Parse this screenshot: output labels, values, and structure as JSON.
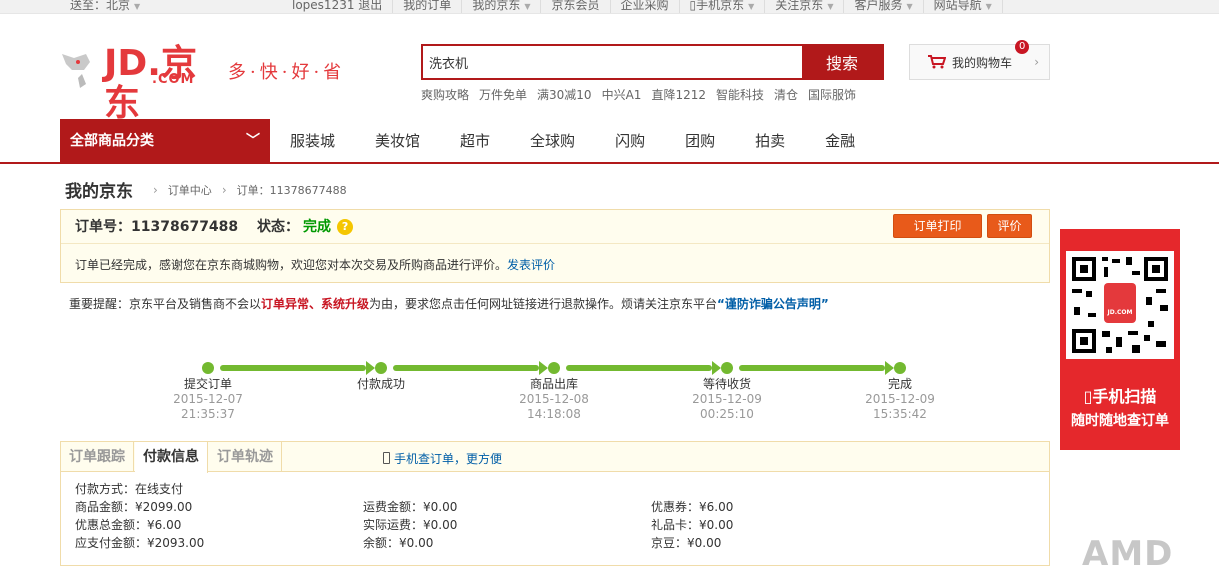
{
  "topbar": {
    "location": "送至：北京",
    "links": [
      "lopes1231  退出",
      "我的订单",
      "我的京东",
      "京东会员",
      "企业采购",
      "手机京东",
      "关注京东",
      "客户服务",
      "网站导航"
    ]
  },
  "logo": {
    "text": "JD.京东",
    "sub": ".COM"
  },
  "slogan": "多·快·好·省",
  "search": {
    "value": "洗衣机",
    "button": "搜索"
  },
  "hotwords": [
    "爽购攻略",
    "万件免单",
    "满30减10",
    "中兴A1",
    "直降1212",
    "智能科技",
    "清仓",
    "国际服饰"
  ],
  "cart": {
    "label": "我的购物车",
    "count": "0"
  },
  "nav": {
    "all_categories": "全部商品分类",
    "items": [
      "服装城",
      "美妆馆",
      "超市",
      "全球购",
      "闪购",
      "团购",
      "拍卖",
      "金融"
    ]
  },
  "breadcrumb": {
    "home": "我的京东",
    "level1": "订单中心",
    "level2": "订单：11378677488"
  },
  "order": {
    "number_label": "订单号：",
    "number": "11378677488",
    "status_label": "状态：",
    "status": "完成",
    "print_button": "订单打印",
    "review_button": "评价",
    "message": "订单已经完成，感谢您在京东商城购物，欢迎您对本次交易及所购商品进行评价。",
    "review_link": "发表评价"
  },
  "reminder": {
    "prefix": "重要提醒：京东平台及销售商不会以",
    "highlight": "订单异常、系统升级",
    "middle": "为由，要求您点击任何网址链接进行退款操作。烦请关注京东平台",
    "link": "“谨防诈骗公告声明”"
  },
  "progress": [
    {
      "label": "提交订单",
      "date": "2015-12-07",
      "time": "21:35:37"
    },
    {
      "label": "付款成功",
      "date": "",
      "time": ""
    },
    {
      "label": "商品出库",
      "date": "2015-12-08",
      "time": "14:18:08"
    },
    {
      "label": "等待收货",
      "date": "2015-12-09",
      "time": "00:25:10"
    },
    {
      "label": "完成",
      "date": "2015-12-09",
      "time": "15:35:42"
    }
  ],
  "tabs": {
    "items": [
      "订单跟踪",
      "付款信息",
      "订单轨迹"
    ],
    "mobile_link": "手机查订单，更方便"
  },
  "payment": {
    "method": "付款方式：在线支付",
    "goods_amount": "商品金额：¥2099.00",
    "discount_total": "优惠总金额：¥6.00",
    "payable": "应支付金额：¥2093.00",
    "shipping": "运费金额：¥0.00",
    "actual_shipping": "实际运费：¥0.00",
    "balance": "余额：¥0.00",
    "coupon": "优惠券：¥6.00",
    "gift_card": "礼品卡：¥0.00",
    "jingdou": "京豆：¥0.00"
  },
  "side_panel": {
    "line1": "手机扫描",
    "line2": "随时随地查订单",
    "qr_caption": "JD.COM"
  },
  "watermark": "AMD"
}
